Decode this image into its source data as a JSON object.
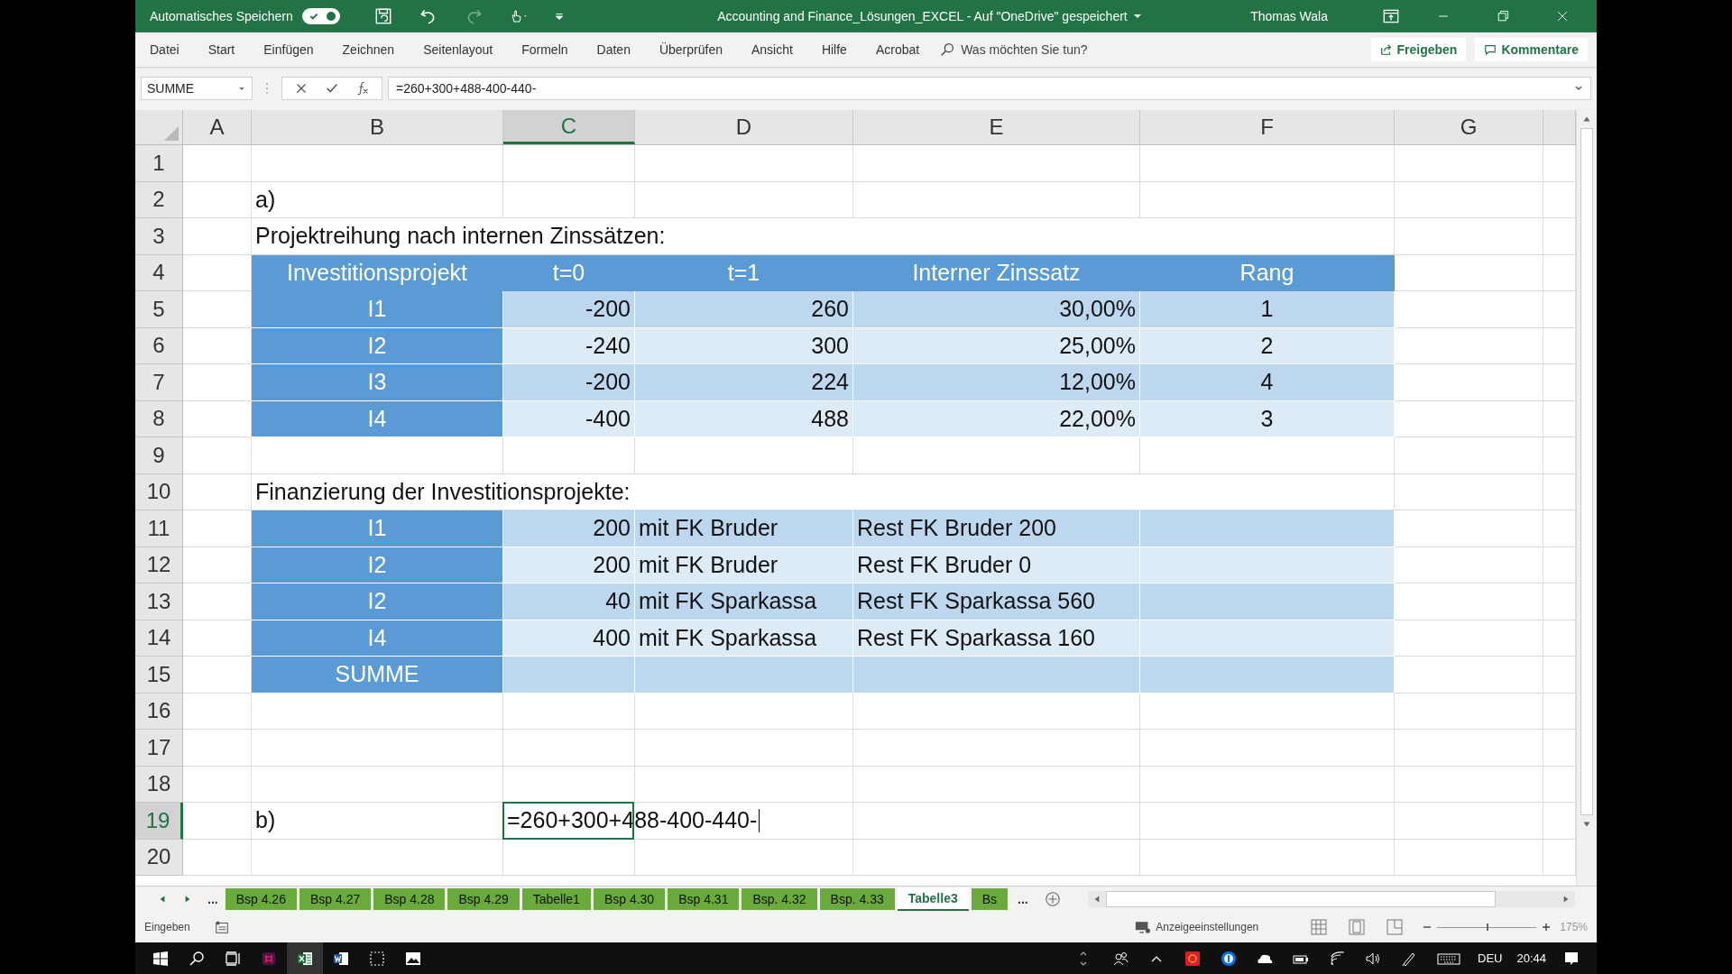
{
  "title_bar": {
    "autosave_label": "Automatisches Speichern",
    "autosave_on": true,
    "redo_disabled": true,
    "document_title": "Accounting and Finance_Lösungen_EXCEL  -  Auf \"OneDrive\" gespeichert",
    "user": "Thomas Wala"
  },
  "menu": {
    "items": [
      "Datei",
      "Start",
      "Einfügen",
      "Zeichnen",
      "Seitenlayout",
      "Formeln",
      "Daten",
      "Überprüfen",
      "Ansicht",
      "Hilfe",
      "Acrobat"
    ],
    "search_placeholder": "Was möchten Sie tun?",
    "share": "Freigeben",
    "comments": "Kommentare"
  },
  "formula_bar": {
    "name_box": "SUMME",
    "formula": "=260+300+488-400-440-"
  },
  "columns": [
    {
      "label": "A",
      "selected": false
    },
    {
      "label": "B",
      "selected": false
    },
    {
      "label": "C",
      "selected": true
    },
    {
      "label": "D",
      "selected": false
    },
    {
      "label": "E",
      "selected": false
    },
    {
      "label": "F",
      "selected": false
    },
    {
      "label": "G",
      "selected": false
    }
  ],
  "rows": [
    {
      "number": "1",
      "selected": false,
      "kind": "plain"
    },
    {
      "number": "2",
      "selected": false,
      "kind": "plain",
      "B": {
        "text": "a)",
        "kind": "text"
      }
    },
    {
      "number": "3",
      "selected": false,
      "kind": "plain",
      "B": {
        "text": "Projektreihung nach internen Zinssätzen:",
        "kind": "title"
      }
    },
    {
      "number": "4",
      "selected": false,
      "kind": "header",
      "B": {
        "text": "Investitionsprojekt",
        "kind": "label"
      },
      "C": {
        "text": "t=0",
        "kind": "label"
      },
      "D": {
        "text": "t=1",
        "kind": "label"
      },
      "E": {
        "text": "Interner Zinssatz",
        "kind": "label"
      },
      "F": {
        "text": "Rang",
        "kind": "label"
      }
    },
    {
      "number": "5",
      "selected": false,
      "kind": "mid",
      "B": {
        "text": "I1",
        "kind": "label"
      },
      "C": {
        "text": "-200",
        "kind": "number"
      },
      "D": {
        "text": "260",
        "kind": "number"
      },
      "E": {
        "text": "30,00%",
        "kind": "number"
      },
      "F": {
        "text": "1",
        "kind": "rank"
      }
    },
    {
      "number": "6",
      "selected": false,
      "kind": "light",
      "B": {
        "text": "I2",
        "kind": "label"
      },
      "C": {
        "text": "-240",
        "kind": "number"
      },
      "D": {
        "text": "300",
        "kind": "number"
      },
      "E": {
        "text": "25,00%",
        "kind": "number"
      },
      "F": {
        "text": "2",
        "kind": "rank"
      }
    },
    {
      "number": "7",
      "selected": false,
      "kind": "mid",
      "B": {
        "text": "I3",
        "kind": "label"
      },
      "C": {
        "text": "-200",
        "kind": "number"
      },
      "D": {
        "text": "224",
        "kind": "number"
      },
      "E": {
        "text": "12,00%",
        "kind": "number"
      },
      "F": {
        "text": "4",
        "kind": "rank"
      }
    },
    {
      "number": "8",
      "selected": false,
      "kind": "light",
      "B": {
        "text": "I4",
        "kind": "label"
      },
      "C": {
        "text": "-400",
        "kind": "number"
      },
      "D": {
        "text": "488",
        "kind": "number"
      },
      "E": {
        "text": "22,00%",
        "kind": "number"
      },
      "F": {
        "text": "3",
        "kind": "rank"
      }
    },
    {
      "number": "9",
      "selected": false,
      "kind": "plain"
    },
    {
      "number": "10",
      "selected": false,
      "kind": "plain",
      "B": {
        "text": "Finanzierung der Investitionsprojekte:",
        "kind": "title"
      }
    },
    {
      "number": "11",
      "selected": false,
      "kind": "mid",
      "B": {
        "text": "I1",
        "kind": "label"
      },
      "C": {
        "text": "200",
        "kind": "number"
      },
      "D": {
        "text": "mit FK Bruder",
        "kind": "text"
      },
      "E": {
        "text": "Rest FK Bruder 200",
        "kind": "text"
      }
    },
    {
      "number": "12",
      "selected": false,
      "kind": "light",
      "B": {
        "text": "I2",
        "kind": "label"
      },
      "C": {
        "text": "200",
        "kind": "number"
      },
      "D": {
        "text": "mit FK Bruder",
        "kind": "text"
      },
      "E": {
        "text": "Rest FK Bruder 0",
        "kind": "text"
      }
    },
    {
      "number": "13",
      "selected": false,
      "kind": "mid",
      "B": {
        "text": "I2",
        "kind": "label"
      },
      "C": {
        "text": "40",
        "kind": "number"
      },
      "D": {
        "text": "mit FK Sparkassa",
        "kind": "text"
      },
      "E": {
        "text": "Rest FK Sparkassa 560",
        "kind": "text"
      }
    },
    {
      "number": "14",
      "selected": false,
      "kind": "light",
      "B": {
        "text": "I4",
        "kind": "label"
      },
      "C": {
        "text": "400",
        "kind": "number"
      },
      "D": {
        "text": "mit FK Sparkassa",
        "kind": "text"
      },
      "E": {
        "text": "Rest FK Sparkassa 160",
        "kind": "text"
      }
    },
    {
      "number": "15",
      "selected": false,
      "kind": "mid",
      "B": {
        "text": "SUMME",
        "kind": "label"
      }
    },
    {
      "number": "16",
      "selected": false,
      "kind": "plain"
    },
    {
      "number": "17",
      "selected": false,
      "kind": "plain"
    },
    {
      "number": "18",
      "selected": false,
      "kind": "plain"
    },
    {
      "number": "19",
      "selected": true,
      "kind": "plain",
      "B": {
        "text": "b)",
        "kind": "text"
      },
      "C": {
        "text": "=260+300+488-400-440-",
        "kind": "editing"
      }
    },
    {
      "number": "20",
      "selected": false,
      "kind": "plain"
    }
  ],
  "sheet_tabs": [
    {
      "label": "Bsp 4.26",
      "selected": false
    },
    {
      "label": "Bsp 4.27",
      "selected": false
    },
    {
      "label": "Bsp 4.28",
      "selected": false
    },
    {
      "label": "Bsp 4.29",
      "selected": false
    },
    {
      "label": "Tabelle1",
      "selected": false
    },
    {
      "label": "Bsp 4.30",
      "selected": false
    },
    {
      "label": "Bsp 4.31",
      "selected": false
    },
    {
      "label": "Bsp. 4.32",
      "selected": false
    },
    {
      "label": "Bsp. 4.33",
      "selected": false
    },
    {
      "label": "Tabelle3",
      "selected": true
    },
    {
      "label": "Bs",
      "selected": false
    }
  ],
  "sheet_nav": {
    "more_left": "...",
    "more_right": "..."
  },
  "status_bar": {
    "mode": "Eingeben",
    "display_settings": "Anzeigeeinstellungen",
    "zoom": "175%",
    "zoom_slider": {
      "level": 0.5
    }
  },
  "taskbar": {
    "language": "DEU",
    "time": "20:44"
  }
}
